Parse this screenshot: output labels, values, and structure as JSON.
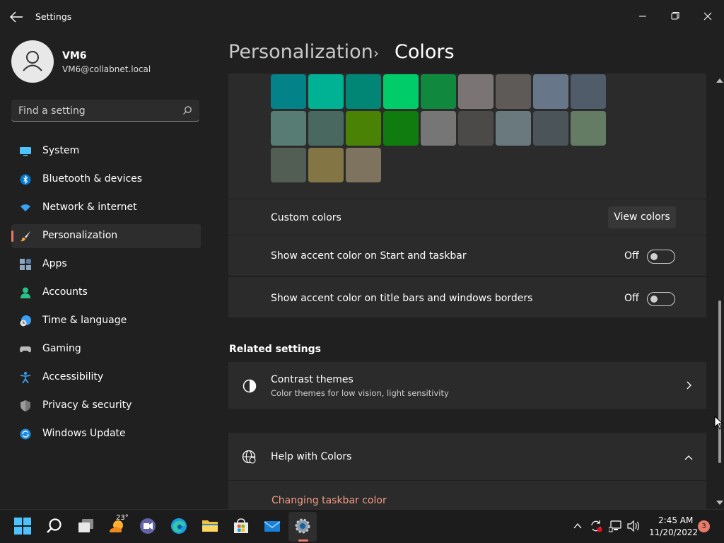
{
  "window": {
    "title": "Settings",
    "controls": [
      "minimize",
      "restore",
      "close"
    ]
  },
  "user": {
    "name": "VM6",
    "email": "VM6@collabnet.local"
  },
  "search": {
    "placeholder": "Find a setting"
  },
  "sidebar": {
    "items": [
      {
        "label": "System",
        "icon": "monitor-icon"
      },
      {
        "label": "Bluetooth & devices",
        "icon": "bluetooth-icon"
      },
      {
        "label": "Network & internet",
        "icon": "wifi-icon"
      },
      {
        "label": "Personalization",
        "icon": "brush-icon",
        "active": true
      },
      {
        "label": "Apps",
        "icon": "apps-icon"
      },
      {
        "label": "Accounts",
        "icon": "person-icon"
      },
      {
        "label": "Time & language",
        "icon": "clock-globe-icon"
      },
      {
        "label": "Gaming",
        "icon": "gamepad-icon"
      },
      {
        "label": "Accessibility",
        "icon": "accessibility-icon"
      },
      {
        "label": "Privacy & security",
        "icon": "shield-icon"
      },
      {
        "label": "Windows Update",
        "icon": "update-icon"
      }
    ]
  },
  "breadcrumb": {
    "parent": "Personalization",
    "separator": "›",
    "current": "Colors"
  },
  "palette": [
    "#038387",
    "#00b294",
    "#018574",
    "#00cc6a",
    "#10893e",
    "#7a7574",
    "#5d5a58",
    "#68768a",
    "#515c6b",
    "#567c73",
    "#486860",
    "#498205",
    "#107c10",
    "#767676",
    "#4c4a48",
    "#69797e",
    "#4a5459",
    "#647c64",
    "#525e54",
    "#847545",
    "#7e735f"
  ],
  "settings": {
    "custom_colors_label": "Custom colors",
    "view_colors_button": "View colors",
    "accent_start_label": "Show accent color on Start and taskbar",
    "accent_start_state": "Off",
    "accent_titlebar_label": "Show accent color on title bars and windows borders",
    "accent_titlebar_state": "Off"
  },
  "related": {
    "heading": "Related settings",
    "contrast_title": "Contrast themes",
    "contrast_subtitle": "Color themes for low vision, light sensitivity"
  },
  "help": {
    "title": "Help with Colors",
    "link": "Changing taskbar color"
  },
  "taskbar": {
    "apps": [
      "start-icon",
      "search-icon",
      "task-view-icon",
      "weather-icon",
      "teams-chat-icon",
      "edge-icon",
      "file-explorer-icon",
      "store-icon",
      "mail-icon",
      "settings-icon"
    ],
    "weather_temp": "23°",
    "time": "2:45 AM",
    "date": "11/20/2022",
    "notifications": "3"
  },
  "colors": {
    "accent": "#e97a6a",
    "background": "#202020",
    "card": "#2b2b2b",
    "link": "#f29c86"
  }
}
